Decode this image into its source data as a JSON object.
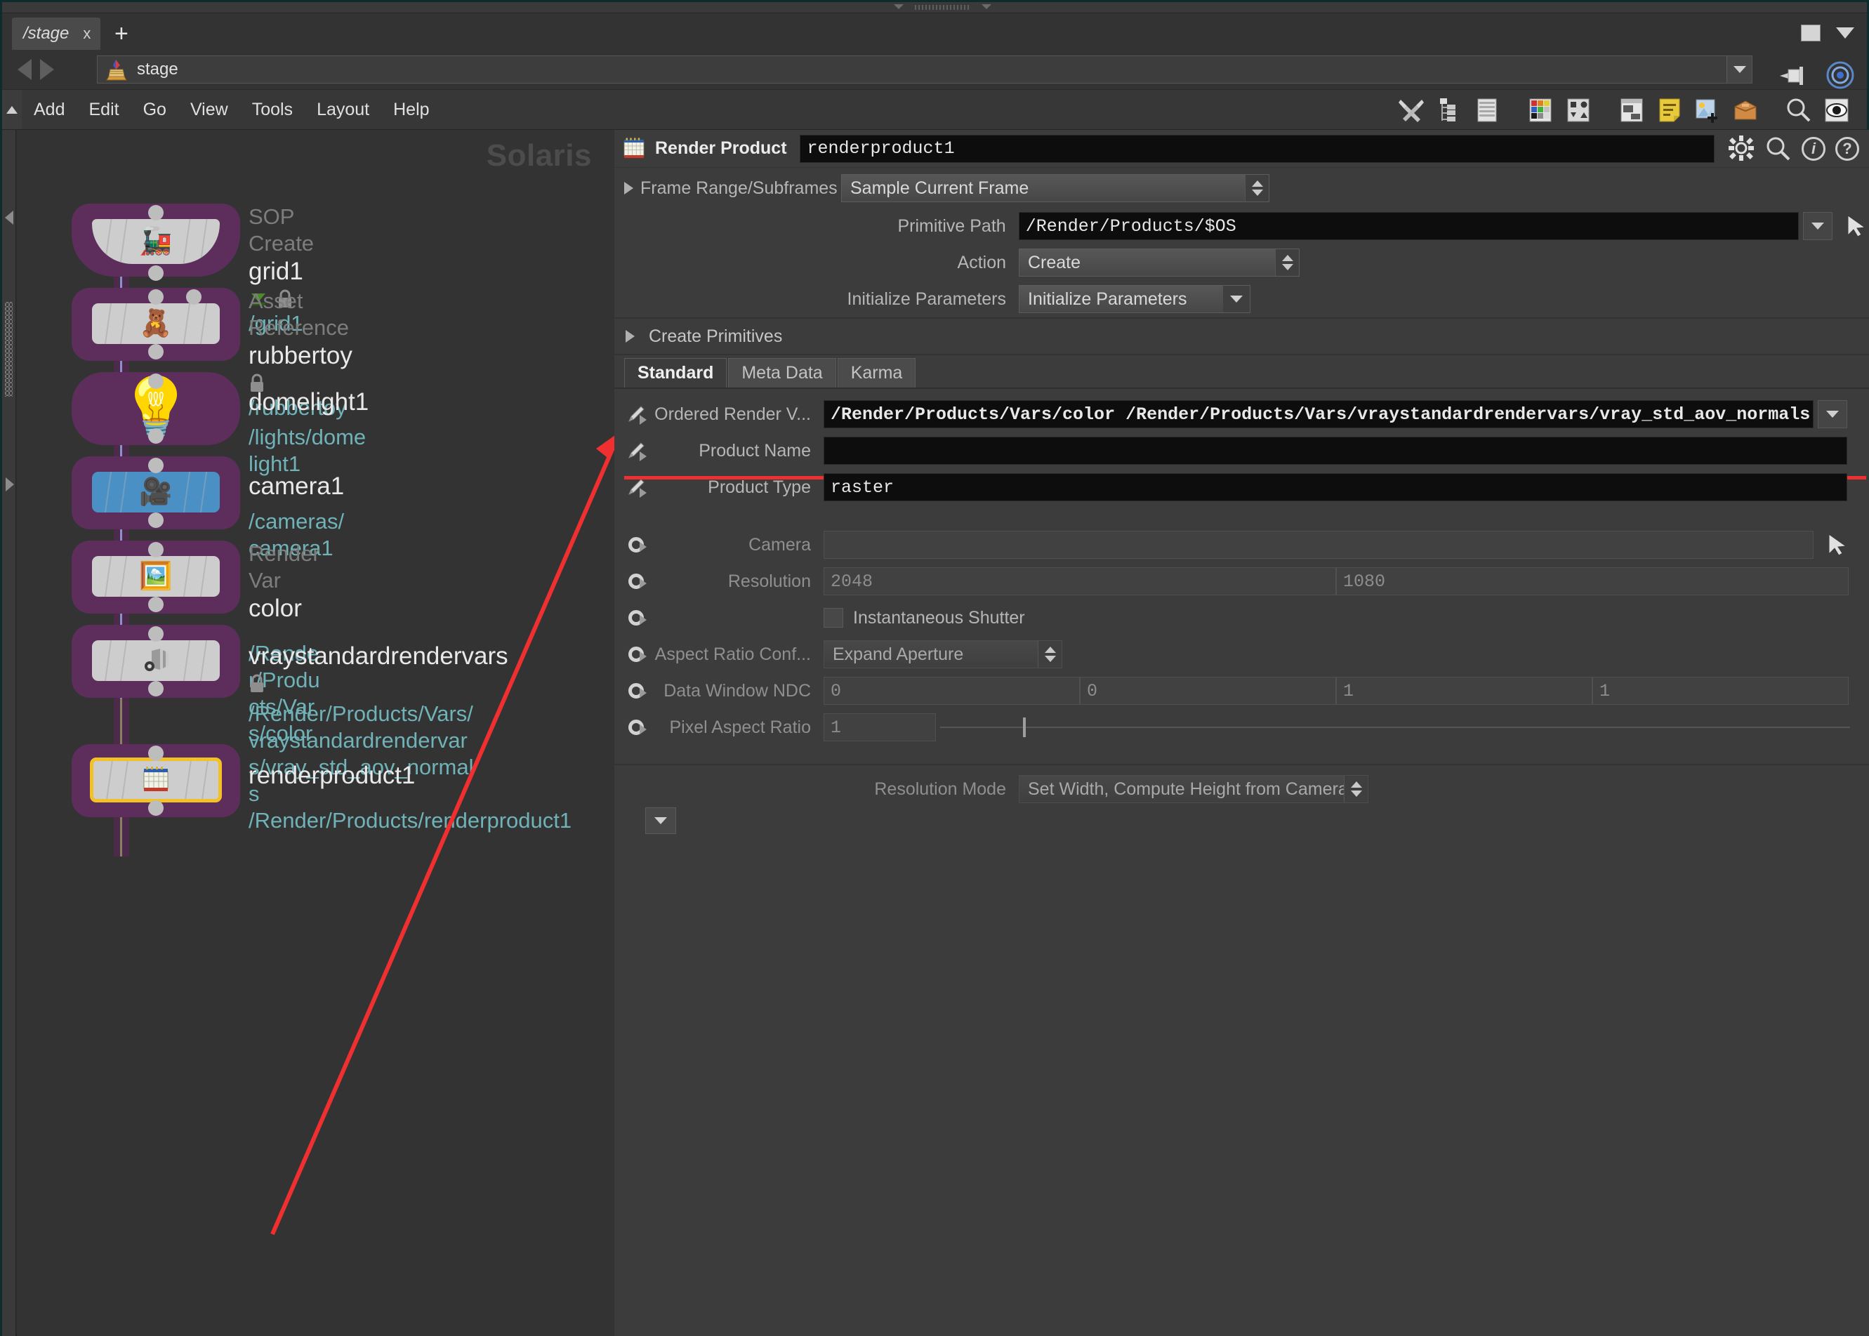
{
  "window": {
    "restore_label": "restore",
    "dropdown_label": "window-menu"
  },
  "tabbar": {
    "tab_label": "/stage",
    "close_label": "x",
    "add_label": "+"
  },
  "pathbar": {
    "value": "stage",
    "icon": "stage-icon",
    "back_label": "Back",
    "forward_label": "Forward",
    "pin_label": "pin",
    "target_label": "target"
  },
  "menubar": {
    "items": [
      "Add",
      "Edit",
      "Go",
      "View",
      "Tools",
      "Layout",
      "Help"
    ],
    "toolbar_icons": [
      "tools-icon",
      "tree-icon",
      "list-icon",
      "palette-icon",
      "layout-grid-icon",
      "panes-icon",
      "notes-icon",
      "image-add-icon",
      "package-icon",
      "search-icon",
      "eye-icon"
    ]
  },
  "graph": {
    "watermark": "Solaris",
    "nodes": [
      {
        "type": "SOP Create",
        "name": "grid1",
        "path": "/grid1",
        "icon": "toy-train-icon",
        "shape": "oval",
        "flags": [
          "display-flag-icon",
          "lock-icon"
        ],
        "selected": false,
        "inputs": 1
      },
      {
        "type": "Asset Reference",
        "name": "rubbertoy",
        "path": "/rubbertoy",
        "icon": "teddy-bear-icon",
        "shape": "rect",
        "flags": [
          "lock-icon"
        ],
        "selected": false,
        "inputs": 2
      },
      {
        "type": "",
        "name": "domelight1",
        "path": "/lights/domelight1",
        "icon": "light-bulb-icon",
        "shape": "bulb",
        "flags": [],
        "selected": false,
        "inputs": 1
      },
      {
        "type": "",
        "name": "camera1",
        "path": "/cameras/camera1",
        "icon": "movie-camera-icon",
        "shape": "camera",
        "flags": [],
        "selected": false,
        "inputs": 1
      },
      {
        "type": "Render Var",
        "name": "color",
        "path": "/Render/Products/Vars/color",
        "icon": "framed-picture-icon",
        "shape": "rect",
        "flags": [],
        "selected": false,
        "inputs": 1
      },
      {
        "type": "",
        "name": "vraystandardrendervars",
        "path": "/Render/Products/Vars/vraystandardrendervars/vray_std_aov_normals",
        "icon": "render-vars-icon",
        "shape": "rect",
        "flags": [
          "lock-icon"
        ],
        "selected": false,
        "inputs": 1
      },
      {
        "type": "",
        "name": "renderproduct1",
        "path": "/Render/Products/renderproduct1",
        "icon": "render-product-icon",
        "shape": "rect",
        "flags": [],
        "selected": true,
        "inputs": 1
      }
    ]
  },
  "params": {
    "header": {
      "icon": "render-product-icon",
      "title": "Render Product",
      "node_name": "renderproduct1",
      "buttons": [
        "gear-icon",
        "search-icon",
        "info-icon",
        "help-icon"
      ]
    },
    "frame_range": {
      "label": "Frame Range/Subframes",
      "value": "Sample Current Frame"
    },
    "primitive_path": {
      "label": "Primitive Path",
      "value": "/Render/Products/$OS"
    },
    "action": {
      "label": "Action",
      "value": "Create"
    },
    "initialize_parameters": {
      "label": "Initialize Parameters",
      "value": "Initialize Parameters"
    },
    "create_primitives": {
      "label": "Create Primitives"
    },
    "tabs": [
      {
        "label": "Standard",
        "active": true
      },
      {
        "label": "Meta Data",
        "active": false
      },
      {
        "label": "Karma",
        "active": false
      }
    ],
    "rows": [
      {
        "label": "Ordered Render V...",
        "value": "/Render/Products/Vars/color  /Render/Products/Vars/vraystandardrendervars/vray_std_aov_normals",
        "kind": "text-dark",
        "icon": "pen-icon",
        "highlighted": true
      },
      {
        "label": "Product Name",
        "value": "",
        "kind": "text-dark",
        "icon": "pen-icon",
        "highlighted": false
      },
      {
        "label": "Product Type",
        "value": "raster",
        "kind": "text-dark",
        "icon": "pen-icon",
        "highlighted": false
      }
    ],
    "camera": {
      "label": "Camera",
      "value": "",
      "icon": "ring-icon"
    },
    "resolution": {
      "label": "Resolution",
      "width": "2048",
      "height": "1080",
      "icon": "ring-icon"
    },
    "instantaneous_shutter": {
      "label": "Instantaneous Shutter",
      "checked": false,
      "icon": "ring-icon"
    },
    "aspect_ratio_conform": {
      "label": "Aspect Ratio Conf...",
      "value": "Expand Aperture",
      "icon": "ring-icon"
    },
    "data_window_ndc": {
      "label": "Data Window NDC",
      "values": [
        "0",
        "0",
        "1",
        "1"
      ],
      "icon": "ring-icon"
    },
    "pixel_aspect_ratio": {
      "label": "Pixel Aspect Ratio",
      "value": "1",
      "icon": "ring-icon"
    },
    "resolution_mode": {
      "label": "Resolution Mode",
      "value": "Set Width, Compute Height from Camera"
    },
    "expand_more_label": "expand-more"
  },
  "colors": {
    "node_halo": "#5d2e5c",
    "node_card": "#cdcdcd",
    "node_selected_outline": "#f2c125",
    "path_text": "#6fb2b7",
    "annotation": "#f03030",
    "panel_bg": "#3c3c3c",
    "graph_bg": "#333333"
  }
}
